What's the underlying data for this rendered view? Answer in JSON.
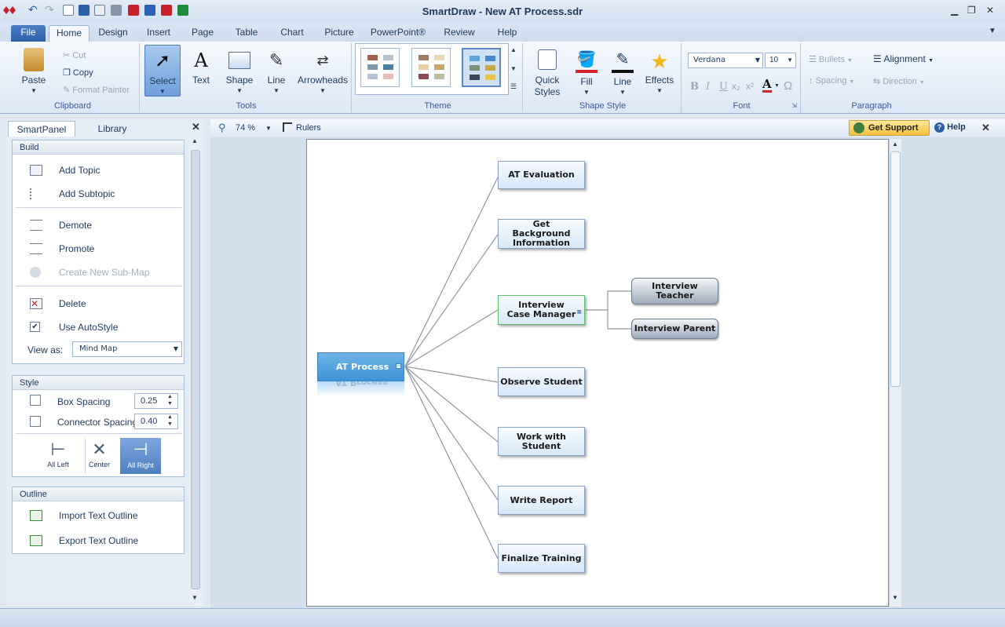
{
  "app": {
    "title": "SmartDraw - New AT Process.sdr"
  },
  "tabs": [
    "File",
    "Home",
    "Design",
    "Insert",
    "Page",
    "Table",
    "Chart",
    "Picture",
    "PowerPoint®",
    "Review",
    "Help"
  ],
  "ribbon": {
    "clipboard": {
      "label": "Clipboard",
      "paste": "Paste",
      "cut": "Cut",
      "copy": "Copy",
      "format_painter": "Format Painter"
    },
    "tools": {
      "label": "Tools",
      "select": "Select",
      "text": "Text",
      "shape": "Shape",
      "line": "Line",
      "arrowheads": "Arrowheads"
    },
    "theme": {
      "label": "Theme"
    },
    "shape_style": {
      "label": "Shape Style",
      "quick_styles": "Quick Styles",
      "fill": "Fill",
      "line": "Line",
      "effects": "Effects"
    },
    "font": {
      "label": "Font",
      "family": "Verdana",
      "size": "10",
      "bold": "B",
      "italic": "I",
      "underline": "U"
    },
    "paragraph": {
      "label": "Paragraph",
      "bullets": "Bullets",
      "alignment": "Alignment",
      "spacing": "Spacing",
      "direction": "Direction"
    }
  },
  "panel": {
    "tab_smart": "SmartPanel",
    "tab_library": "Library",
    "build": {
      "header": "Build",
      "add_topic": "Add Topic",
      "add_subtopic": "Add Subtopic",
      "demote": "Demote",
      "promote": "Promote",
      "create_submap": "Create New Sub-Map",
      "delete": "Delete",
      "use_autostyle": "Use AutoStyle",
      "view_as_label": "View as:",
      "view_as_value": "Mind Map"
    },
    "style": {
      "header": "Style",
      "box_spacing_label": "Box Spacing",
      "box_spacing": "0.25",
      "connector_spacing_label": "Connector Spacing",
      "connector_spacing": "0.40",
      "all_left": "All Left",
      "center": "Center",
      "all_right": "All Right"
    },
    "outline": {
      "header": "Outline",
      "import": "Import Text Outline",
      "export": "Export Text Outline"
    }
  },
  "toolstrip": {
    "zoom": "74 %",
    "rulers": "Rulers",
    "get_support": "Get Support",
    "help": "Help"
  },
  "diagram": {
    "root": "AT Process",
    "root_reflection": "AT Process",
    "topics": [
      "AT Evaluation",
      "Get Background Information",
      "Interview Case Manager",
      "Observe Student",
      "Work with Student",
      "Write Report",
      "Finalize Training"
    ],
    "subtopics": [
      "Interview Teacher",
      "Interview Parent"
    ]
  }
}
